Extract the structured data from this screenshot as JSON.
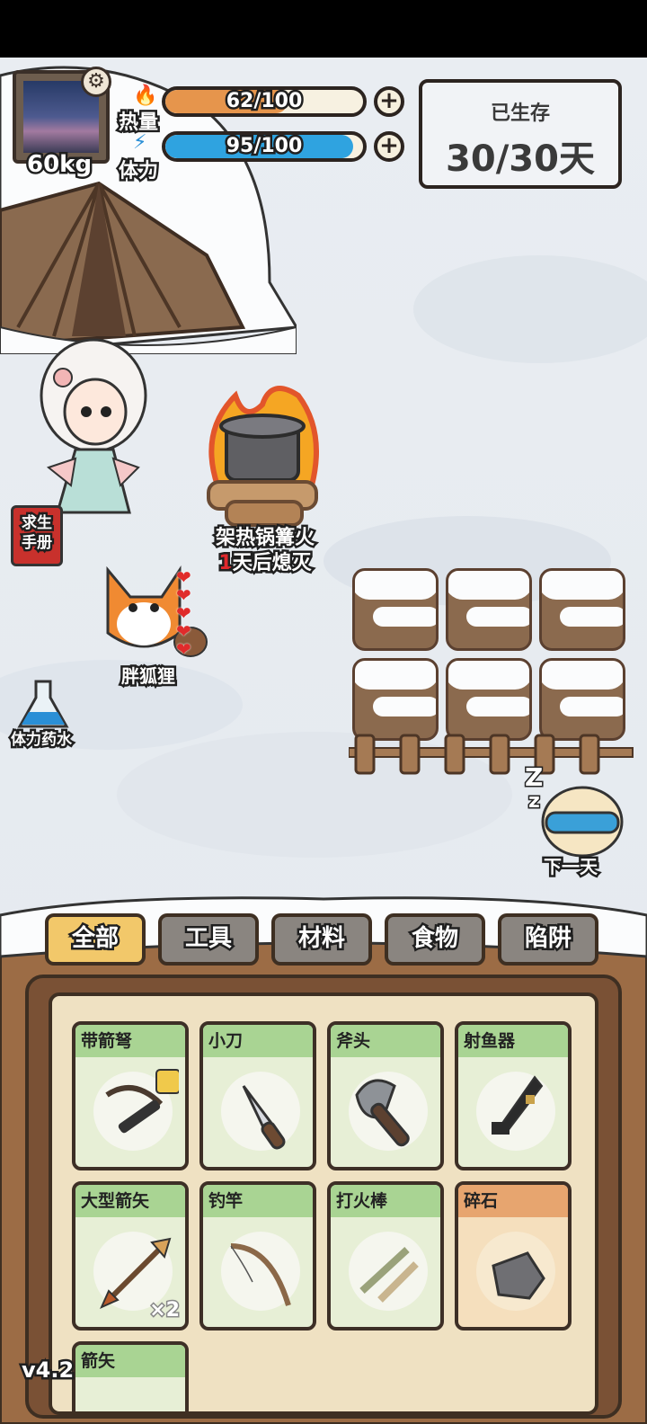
{
  "status": {
    "weight": "60kg",
    "heat": {
      "label": "热量",
      "value_text": "62/100",
      "value": 62,
      "max": 100,
      "color": "#e6954c"
    },
    "stamina": {
      "label": "体力",
      "value_text": "95/100",
      "value": 95,
      "max": 100,
      "color": "#2fa3e0"
    }
  },
  "survival": {
    "title": "已生存",
    "value": "30/30天"
  },
  "scene": {
    "campfire_name": "架热锅篝火",
    "campfire_days": "1",
    "campfire_suffix": "天后熄灭",
    "pet_name": "胖狐狸",
    "side_manual": "求生\n手册",
    "side_potion": "体力药水",
    "next_day": "下一天"
  },
  "tabs": [
    {
      "label": "全部",
      "active": true
    },
    {
      "label": "工具",
      "active": false
    },
    {
      "label": "材料",
      "active": false
    },
    {
      "label": "食物",
      "active": false
    },
    {
      "label": "陷阱",
      "active": false
    }
  ],
  "items": [
    {
      "name": "带箭弩",
      "icon": "crossbow-icon"
    },
    {
      "name": "小刀",
      "icon": "knife-icon"
    },
    {
      "name": "斧头",
      "icon": "axe-icon"
    },
    {
      "name": "射鱼器",
      "icon": "spear-gun-icon"
    },
    {
      "name": "大型箭矢",
      "icon": "arrow-icon",
      "qty": "×2"
    },
    {
      "name": "钓竿",
      "icon": "fishing-rod-icon"
    },
    {
      "name": "打火棒",
      "icon": "fire-stick-icon"
    },
    {
      "name": "碎石",
      "icon": "stone-icon"
    },
    {
      "name": "箭矢",
      "icon": "arrow-icon"
    }
  ],
  "version": "v4.2"
}
